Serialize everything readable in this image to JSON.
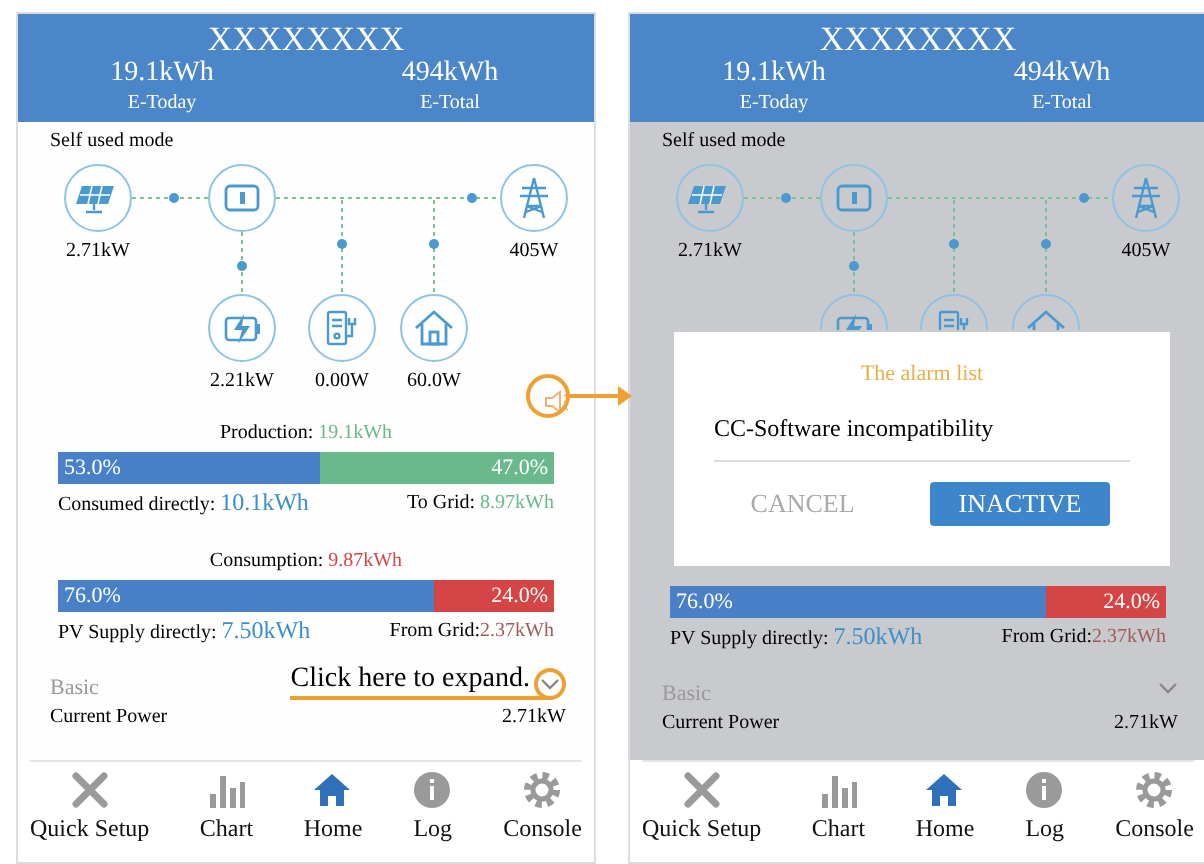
{
  "screens": [
    {
      "dimmed": false,
      "header": {
        "title": "XXXXXXXX",
        "today_value": "19.1kWh",
        "today_label": "E-Today",
        "total_value": "494kWh",
        "total_label": "E-Total"
      },
      "mode": "Self used mode",
      "nodes_top": [
        {
          "kind": "solar",
          "value": "2.71kW"
        },
        {
          "kind": "inverter"
        },
        {
          "kind": "tower",
          "value": "405W"
        }
      ],
      "nodes_bottom": [
        {
          "kind": "battery",
          "value": "2.21kW"
        },
        {
          "kind": "charger",
          "value": "0.00W"
        },
        {
          "kind": "house",
          "value": "60.0W"
        }
      ],
      "production": {
        "title": "Production: ",
        "title_value": "19.1kWh",
        "kind": "production",
        "segments": [
          {
            "label": "53.0%",
            "level": 0.53,
            "color": "#4a80c8"
          },
          {
            "label": "47.0%",
            "color": "#6ab98a"
          }
        ],
        "left_label": "Consumed directly: ",
        "left_value": "10.1kWh",
        "right_label": "To Grid: ",
        "right_value": "8.97kWh"
      },
      "consumption": {
        "title": "Consumption: ",
        "title_value": "9.87kWh",
        "kind": "consumption",
        "segments": [
          {
            "label": "76.0%",
            "level": 0.76,
            "color": "#4a80c8"
          },
          {
            "label": "24.0%",
            "color": "#d64545"
          }
        ],
        "left_label": "PV Supply directly: ",
        "left_value": "7.50kWh",
        "right_label": "From Grid:",
        "right_value": "2.37kWh"
      },
      "basic": {
        "label": "Basic",
        "callout": "Click here to expand.",
        "current_power_label": "Current Power",
        "current_power": "2.71kW"
      },
      "nav": [
        {
          "label": "Quick Setup",
          "kind": "tools",
          "selected": false
        },
        {
          "label": "Chart",
          "kind": "chart",
          "selected": false
        },
        {
          "label": "Home",
          "kind": "home",
          "selected": true
        },
        {
          "label": "Log",
          "kind": "info",
          "selected": false
        },
        {
          "label": "Console",
          "kind": "gear",
          "selected": false
        }
      ]
    },
    {
      "dimmed": true,
      "header": {
        "title": "XXXXXXXX",
        "today_value": "19.1kWh",
        "today_label": "E-Today",
        "total_value": "494kWh",
        "total_label": "E-Total"
      },
      "mode": "Self used mode",
      "nodes_top": [
        {
          "kind": "solar",
          "value": "2.71kW"
        },
        {
          "kind": "inverter"
        },
        {
          "kind": "tower",
          "value": "405W"
        }
      ],
      "nodes_bottom": [
        {
          "kind": "battery"
        },
        {
          "kind": "charger"
        },
        {
          "kind": "house"
        }
      ],
      "dialog": {
        "title": "The alarm list",
        "message": "CC-Software incompatibility",
        "buttons": [
          {
            "label": "CANCEL",
            "kind": "text"
          },
          {
            "label": "INACTIVE",
            "kind": "primary"
          }
        ]
      },
      "consumption": {
        "kind": "consumption",
        "segments": [
          {
            "label": "76.0%",
            "level": 0.76,
            "color": "#4a80c8"
          },
          {
            "label": "24.0%",
            "color": "#d64545"
          }
        ],
        "left_label": "PV Supply directly: ",
        "left_value": "7.50kWh",
        "right_label": "From Grid:",
        "right_value": "2.37kWh"
      },
      "basic": {
        "label": "Basic",
        "current_power_label": "Current Power",
        "current_power": "2.71kW"
      },
      "nav": [
        {
          "label": "Quick Setup",
          "kind": "tools",
          "selected": false
        },
        {
          "label": "Chart",
          "kind": "chart",
          "selected": false
        },
        {
          "label": "Home",
          "kind": "home",
          "selected": true
        },
        {
          "label": "Log",
          "kind": "info",
          "selected": false
        },
        {
          "label": "Console",
          "kind": "gear",
          "selected": false
        }
      ]
    }
  ]
}
